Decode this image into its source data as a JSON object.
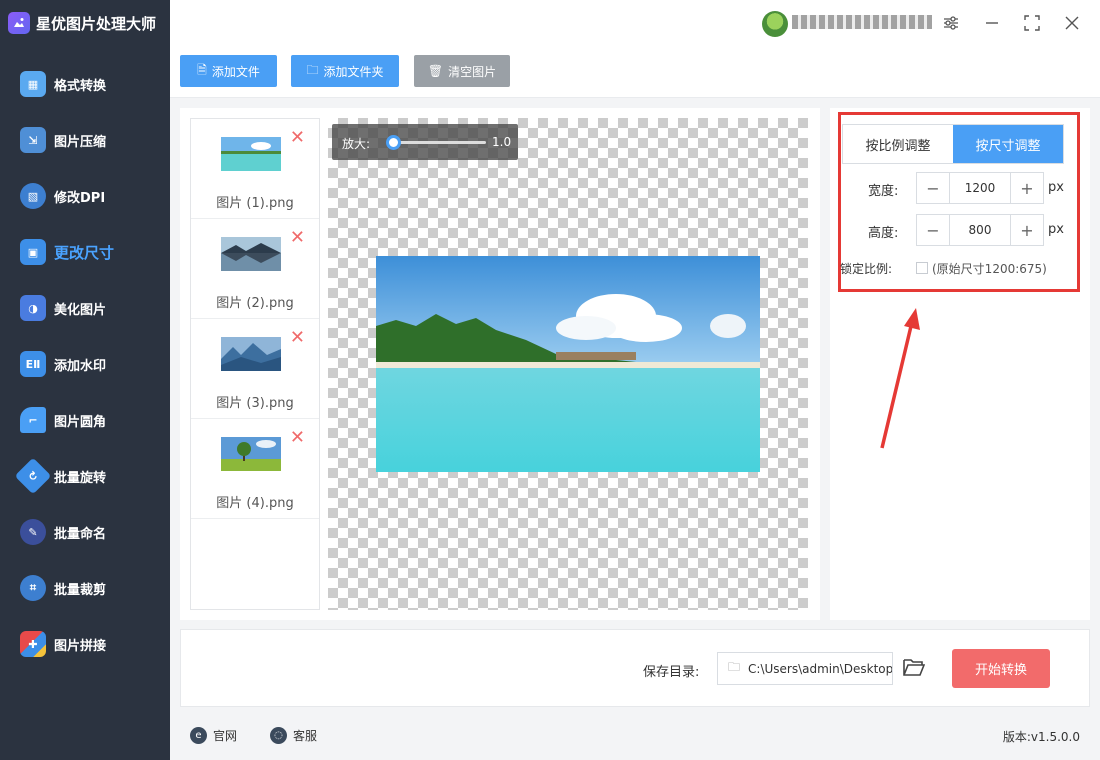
{
  "app": {
    "title": "星优图片处理大师"
  },
  "sidebar": {
    "items": [
      {
        "label": "格式转换",
        "icon": "image-convert-icon",
        "color": "#5aa9f0"
      },
      {
        "label": "图片压缩",
        "icon": "image-compress-icon",
        "color": "#4f8fd6"
      },
      {
        "label": "修改DPI",
        "icon": "dpi-icon",
        "color": "#3d7fd0"
      },
      {
        "label": "更改尺寸",
        "icon": "resize-icon",
        "color": "#3d8fe8",
        "active": true
      },
      {
        "label": "美化图片",
        "icon": "beautify-icon",
        "color": "#4a7ce0"
      },
      {
        "label": "添加水印",
        "icon": "watermark-icon",
        "color": "#3d8fe8"
      },
      {
        "label": "图片圆角",
        "icon": "rounded-corner-icon",
        "color": "#4a9ff5"
      },
      {
        "label": "批量旋转",
        "icon": "rotate-icon",
        "color": "#3d8fe8"
      },
      {
        "label": "批量命名",
        "icon": "rename-icon",
        "color": "#3b4f9b"
      },
      {
        "label": "批量裁剪",
        "icon": "crop-icon",
        "color": "#3d7fd0"
      },
      {
        "label": "图片拼接",
        "icon": "puzzle-icon",
        "color": "#e84a4a"
      }
    ]
  },
  "toolbar": {
    "add_file": "添加文件",
    "add_folder": "添加文件夹",
    "clear": "清空图片"
  },
  "files": [
    {
      "name": "图片 (1).png",
      "thumb": "beach"
    },
    {
      "name": "图片 (2).png",
      "thumb": "lake"
    },
    {
      "name": "图片 (3).png",
      "thumb": "mountain"
    },
    {
      "name": "图片 (4).png",
      "thumb": "tree"
    }
  ],
  "zoom": {
    "label": "放大:",
    "value": "1.0",
    "level": 0.0
  },
  "settings": {
    "tab_ratio": "按比例调整",
    "tab_size": "按尺寸调整",
    "active_tab": "size",
    "width_label": "宽度:",
    "width_value": "1200",
    "height_label": "高度:",
    "height_value": "800",
    "unit": "px",
    "minus": "−",
    "plus": "+",
    "lock_label": "锁定比例:",
    "lock_checked": false,
    "original_size": "(原始尺寸1200:675)"
  },
  "bottom": {
    "save_label": "保存目录:",
    "save_path": "C:\\Users\\admin\\Desktop",
    "start": "开始转换"
  },
  "footer": {
    "website": "官网",
    "support": "客服",
    "version": "版本:v1.5.0.0"
  },
  "colors": {
    "accent": "#4a9ff5",
    "start_button": "#f26b6b",
    "highlight": "#e53935",
    "sidebar_bg": "#2b3340"
  }
}
